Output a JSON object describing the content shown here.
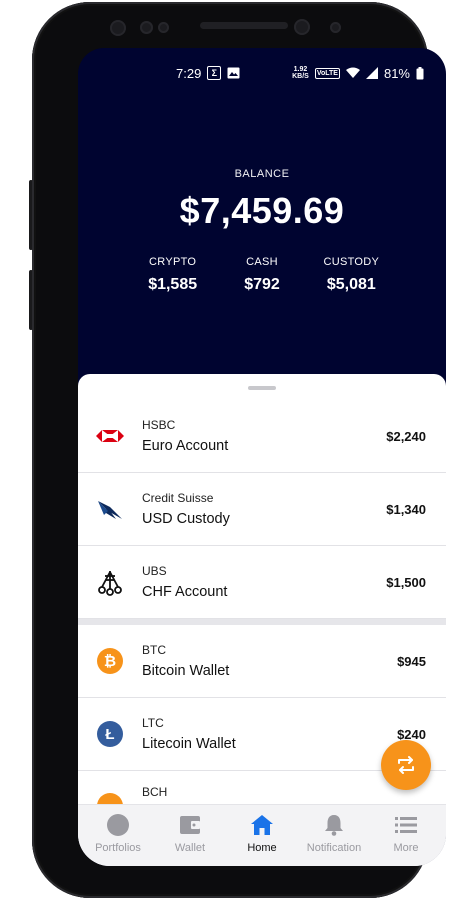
{
  "status_bar": {
    "time": "7:29",
    "notif_icons": [
      "sigma-icon",
      "image-icon"
    ],
    "net_speed_top": "1.92",
    "net_speed_bottom": "KB/S",
    "volte": "VoLTE",
    "battery": "81%"
  },
  "balance": {
    "label": "BALANCE",
    "value": "$7,459.69",
    "breakdown": [
      {
        "label": "CRYPTO",
        "value": "$1,585"
      },
      {
        "label": "CASH",
        "value": "$792"
      },
      {
        "label": "CUSTODY",
        "value": "$5,081"
      }
    ]
  },
  "accounts": [
    {
      "provider": "HSBC",
      "name": "Euro Account",
      "amount": "$2,240",
      "icon": "hsbc-logo-icon"
    },
    {
      "provider": "Credit Suisse",
      "name": "USD Custody",
      "amount": "$1,340",
      "icon": "credit-suisse-logo-icon"
    },
    {
      "provider": "UBS",
      "name": "CHF Account",
      "amount": "$1,500",
      "icon": "ubs-logo-icon"
    }
  ],
  "wallets": [
    {
      "ticker": "BTC",
      "name": "Bitcoin Wallet",
      "amount": "$945",
      "icon": "bitcoin-icon",
      "color": "#f7931a",
      "glyph": "₿"
    },
    {
      "ticker": "LTC",
      "name": "Litecoin Wallet",
      "amount": "$240",
      "icon": "litecoin-icon",
      "color": "#345d9d",
      "glyph": "Ł"
    },
    {
      "ticker": "BCH",
      "name": "",
      "amount": "",
      "icon": "bitcoin-cash-icon",
      "color": "#f7931a",
      "glyph": ""
    }
  ],
  "fab": {
    "icon": "swap-icon",
    "color": "#f7931a"
  },
  "nav": [
    {
      "label": "Portfolios",
      "icon": "portfolio-icon"
    },
    {
      "label": "Wallet",
      "icon": "wallet-icon"
    },
    {
      "label": "Home",
      "icon": "home-icon",
      "active": true
    },
    {
      "label": "Notification",
      "icon": "bell-icon"
    },
    {
      "label": "More",
      "icon": "menu-icon"
    }
  ],
  "colors": {
    "header_bg": "#000430",
    "accent": "#1a73e8",
    "fab": "#f7931a"
  }
}
